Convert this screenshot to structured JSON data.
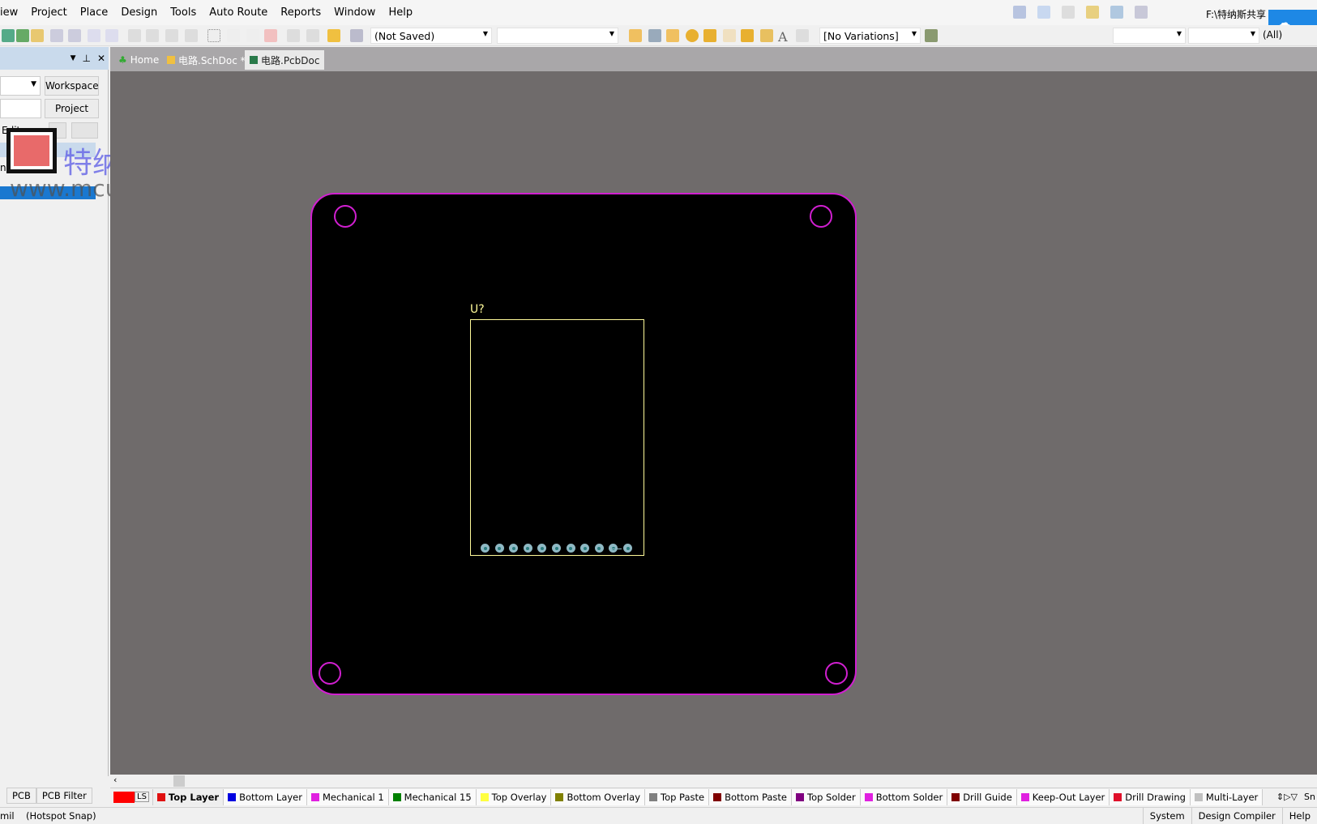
{
  "menu": [
    "iew",
    "Project",
    "Place",
    "Design",
    "Tools",
    "Auto Route",
    "Reports",
    "Window",
    "Help"
  ],
  "toolbar": {
    "saved_combo": "(Not Saved)",
    "variations_combo": "[No Variations]",
    "filter_combo": "(All)",
    "path_text": "F:\\特纳斯共享"
  },
  "tabs": [
    {
      "label": "Home"
    },
    {
      "label": "电路.SchDoc *"
    },
    {
      "label": "电路.PcbDoc",
      "active": true
    }
  ],
  "panel": {
    "workspace_btn": "Workspace",
    "project_btn": "Project",
    "editor_label": "Editor",
    "item_fragment": "nts",
    "bottom_tabs": [
      "PCB",
      "PCB Filter"
    ]
  },
  "watermark": {
    "brand": "特纳斯电子",
    "url": "www.mcude.com"
  },
  "pcb": {
    "designator": "U?",
    "pad_count": 11,
    "board_outline_color": "#d11fd1",
    "overlay_color": "#fffa9a"
  },
  "layers": [
    {
      "label": "Top Layer",
      "color": "#e01010",
      "active": true
    },
    {
      "label": "Bottom Layer",
      "color": "#0000e0"
    },
    {
      "label": "Mechanical 1",
      "color": "#e020e0"
    },
    {
      "label": "Mechanical 15",
      "color": "#008000"
    },
    {
      "label": "Top Overlay",
      "color": "#ffff40"
    },
    {
      "label": "Bottom Overlay",
      "color": "#808000"
    },
    {
      "label": "Top Paste",
      "color": "#808080"
    },
    {
      "label": "Bottom Paste",
      "color": "#800000"
    },
    {
      "label": "Top Solder",
      "color": "#800080"
    },
    {
      "label": "Bottom Solder",
      "color": "#e020e0"
    },
    {
      "label": "Drill Guide",
      "color": "#800000"
    },
    {
      "label": "Keep-Out Layer",
      "color": "#e020e0"
    },
    {
      "label": "Drill Drawing",
      "color": "#e0102a"
    },
    {
      "label": "Multi-Layer",
      "color": "#c0c0c0"
    }
  ],
  "layerbar": {
    "ls_label": "LS",
    "snap_fragment": "Sn"
  },
  "status": {
    "unit": "mil",
    "snap": "(Hotspot Snap)",
    "buttons": [
      "System",
      "Design Compiler",
      "Help"
    ]
  }
}
